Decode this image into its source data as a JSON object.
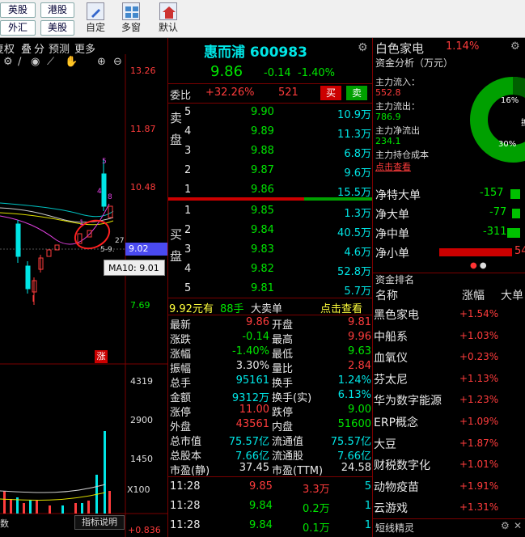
{
  "toolbar": {
    "btn_en": "英股",
    "btn_hk": "港股",
    "btn_fx": "外汇",
    "btn_us": "美股",
    "tool_custom": "自定",
    "tool_multi": "多窗",
    "tool_default": "默认"
  },
  "chart": {
    "tabs": [
      "复权",
      "叠",
      "分",
      "预测",
      "更多"
    ],
    "price_labels": [
      "13.26",
      "11.87",
      "10.48",
      "9.02",
      "7.69"
    ],
    "current_price": "9.02",
    "ma_tooltip": "MA10: 9.01",
    "tag_up": "涨",
    "vol_labels": [
      "4319",
      "2900",
      "1450",
      "X100"
    ],
    "bottom_btn": "指标说明",
    "bottom_left": "数",
    "bottom_value": "+0.836",
    "annot": [
      "5",
      "4",
      "8",
      "1",
      "27",
      "5-9."
    ]
  },
  "quote": {
    "name": "惠而浦",
    "code": "600983",
    "price": "9.86",
    "change": "-0.14",
    "pct": "-1.40%",
    "weibi_label": "委比",
    "weibi_val": "+32.26%",
    "weicha": "521",
    "buy_btn": "买",
    "sell_btn": "卖",
    "sell_label": "卖盘",
    "buy_label": "买盘",
    "asks": [
      {
        "lvl": "5",
        "price": "9.90",
        "vol": "10.9万"
      },
      {
        "lvl": "4",
        "price": "9.89",
        "vol": "11.3万"
      },
      {
        "lvl": "3",
        "price": "9.88",
        "vol": "6.8万"
      },
      {
        "lvl": "2",
        "price": "9.87",
        "vol": "9.6万"
      },
      {
        "lvl": "1",
        "price": "9.86",
        "vol": "15.5万"
      }
    ],
    "bids": [
      {
        "lvl": "1",
        "price": "9.85",
        "vol": "1.3万"
      },
      {
        "lvl": "2",
        "price": "9.84",
        "vol": "40.5万"
      },
      {
        "lvl": "3",
        "price": "9.83",
        "vol": "4.6万"
      },
      {
        "lvl": "4",
        "price": "9.82",
        "vol": "52.8万"
      },
      {
        "lvl": "5",
        "price": "9.81",
        "vol": "5.7万"
      }
    ],
    "bigorder": {
      "a": "9.92元有",
      "b": "88手",
      "c": "大卖单",
      "link": "点击查看"
    },
    "stats": [
      {
        "l1": "最新",
        "v1": "9.86",
        "c1": "red",
        "l2": "开盘",
        "v2": "9.81",
        "c2": "red"
      },
      {
        "l1": "涨跌",
        "v1": "-0.14",
        "c1": "green",
        "l2": "最高",
        "v2": "9.96",
        "c2": "red"
      },
      {
        "l1": "涨幅",
        "v1": "-1.40%",
        "c1": "green",
        "l2": "最低",
        "v2": "9.63",
        "c2": "green"
      },
      {
        "l1": "振幅",
        "v1": "3.30%",
        "c1": "white",
        "l2": "量比",
        "v2": "2.84",
        "c2": "red"
      },
      {
        "l1": "总手",
        "v1": "95161",
        "c1": "cyan",
        "l2": "换手",
        "v2": "1.24%",
        "c2": "cyan"
      },
      {
        "l1": "金额",
        "v1": "9312万",
        "c1": "cyan",
        "l2": "换手(实)",
        "v2": "6.13%",
        "c2": "cyan"
      },
      {
        "l1": "涨停",
        "v1": "11.00",
        "c1": "red",
        "l2": "跌停",
        "v2": "9.00",
        "c2": "green"
      },
      {
        "l1": "外盘",
        "v1": "43561",
        "c1": "red",
        "l2": "内盘",
        "v2": "51600",
        "c2": "green"
      },
      {
        "l1": "总市值",
        "v1": "75.57亿",
        "c1": "cyan",
        "l2": "流通值",
        "v2": "75.57亿",
        "c2": "cyan"
      },
      {
        "l1": "总股本",
        "v1": "7.66亿",
        "c1": "cyan",
        "l2": "流通股",
        "v2": "7.66亿",
        "c2": "cyan"
      },
      {
        "l1": "市盈(静)",
        "v1": "37.45",
        "c1": "white",
        "l2": "市盈(TTM)",
        "v2": "24.58",
        "c2": "white"
      }
    ],
    "ticks": [
      {
        "time": "11:28",
        "price": "9.85",
        "vol": "3.3万",
        "n": "5",
        "c": "red"
      },
      {
        "time": "11:28",
        "price": "9.84",
        "vol": "0.2万",
        "n": "1",
        "c": "green"
      },
      {
        "time": "11:28",
        "price": "9.84",
        "vol": "0.1万",
        "n": "1",
        "c": "green"
      }
    ]
  },
  "sector": {
    "name": "白色家电",
    "pct": "1.14%",
    "title": "资金分析（万元）",
    "inflow_label": "主力流入：",
    "inflow": "552.8",
    "outflow_label": "主力流出：",
    "outflow": "786.9",
    "net_label": "主力净流出",
    "net": "234.1",
    "cost_label": "主力持仓成本",
    "cost_link": "点击查看",
    "donut_a": "16%",
    "donut_b": "30%",
    "donut_c": "换",
    "flows": [
      {
        "label": "净特大单",
        "val": "-157"
      },
      {
        "label": "净大单",
        "val": "-77"
      },
      {
        "label": "净中单",
        "val": "-311"
      },
      {
        "label": "净小单",
        "val": "54"
      }
    ],
    "rank_title": "资金排名",
    "col_name": "名称",
    "col_pct": "涨幅",
    "col_more": "大单",
    "rank": [
      {
        "name": "黑色家电",
        "pct": "+1.54%"
      },
      {
        "name": "中船系",
        "pct": "+1.03%"
      },
      {
        "name": "血氧仪",
        "pct": "+0.23%"
      },
      {
        "name": "芬太尼",
        "pct": "+1.13%"
      },
      {
        "name": "华为数字能源",
        "pct": "+1.23%"
      },
      {
        "name": "ERP概念",
        "pct": "+1.09%"
      },
      {
        "name": "大豆",
        "pct": "+1.87%"
      },
      {
        "name": "财税数字化",
        "pct": "+1.01%"
      },
      {
        "name": "动物疫苗",
        "pct": "+1.91%"
      },
      {
        "name": "云游戏",
        "pct": "+1.31%"
      }
    ],
    "footer": "短线精灵"
  },
  "colors": {
    "up": "#ff3c3c",
    "down": "#00e600",
    "cyan": "#00e6e6",
    "yellow": "#ffff3c",
    "panel_border": "#7a0000"
  }
}
